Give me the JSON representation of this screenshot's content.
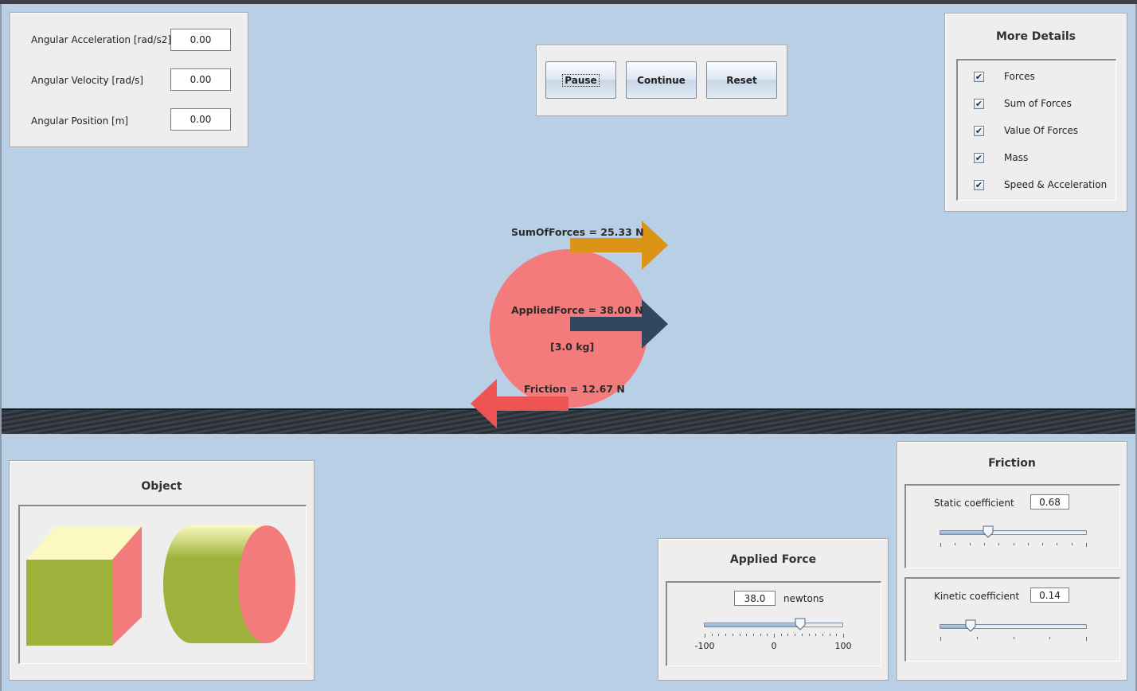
{
  "angular": {
    "acceleration_label": "Angular Acceleration [rad/s2]",
    "acceleration_value": "0.00",
    "velocity_label": "Angular Velocity [rad/s]",
    "velocity_value": "0.00",
    "position_label": "Angular Position [m]",
    "position_value": "0.00"
  },
  "controls": {
    "pause": "Pause",
    "continue": "Continue",
    "reset": "Reset"
  },
  "details": {
    "title": "More Details",
    "items": [
      {
        "label": "Forces",
        "checked": true
      },
      {
        "label": "Sum of Forces",
        "checked": true
      },
      {
        "label": "Value Of Forces",
        "checked": true
      },
      {
        "label": "Mass",
        "checked": true
      },
      {
        "label": "Speed & Acceleration",
        "checked": true
      }
    ]
  },
  "simulation": {
    "sum_of_forces": "SumOfForces = 25.33 N",
    "applied_force": "AppliedForce = 38.00 N",
    "mass": "[3.0 kg]",
    "friction": "Friction = 12.67 N",
    "colors": {
      "object": "#f47b7b",
      "sum_arrow": "#dc9417",
      "applied_arrow": "#32465f",
      "friction_arrow": "#ef5454",
      "ground": "#2f333b",
      "background": "#b8cfe5"
    }
  },
  "object_panel": {
    "title": "Object",
    "shapes": [
      "cube-icon",
      "cylinder-icon"
    ]
  },
  "applied_force": {
    "title": "Applied Force",
    "value": "38.0",
    "unit": "newtons",
    "slider": {
      "min": -100,
      "max": 100,
      "value": 38
    },
    "tick_labels": [
      "-100",
      "0",
      "100"
    ]
  },
  "friction": {
    "title": "Friction",
    "static_label": "Static coefficient",
    "static_value": "0.68",
    "static_slider": {
      "min": 0,
      "max": 1,
      "value": 0.33
    },
    "kinetic_label": "Kinetic coefficient",
    "kinetic_value": "0.14",
    "kinetic_slider": {
      "min": 0,
      "max": 1,
      "value": 0.2
    }
  }
}
